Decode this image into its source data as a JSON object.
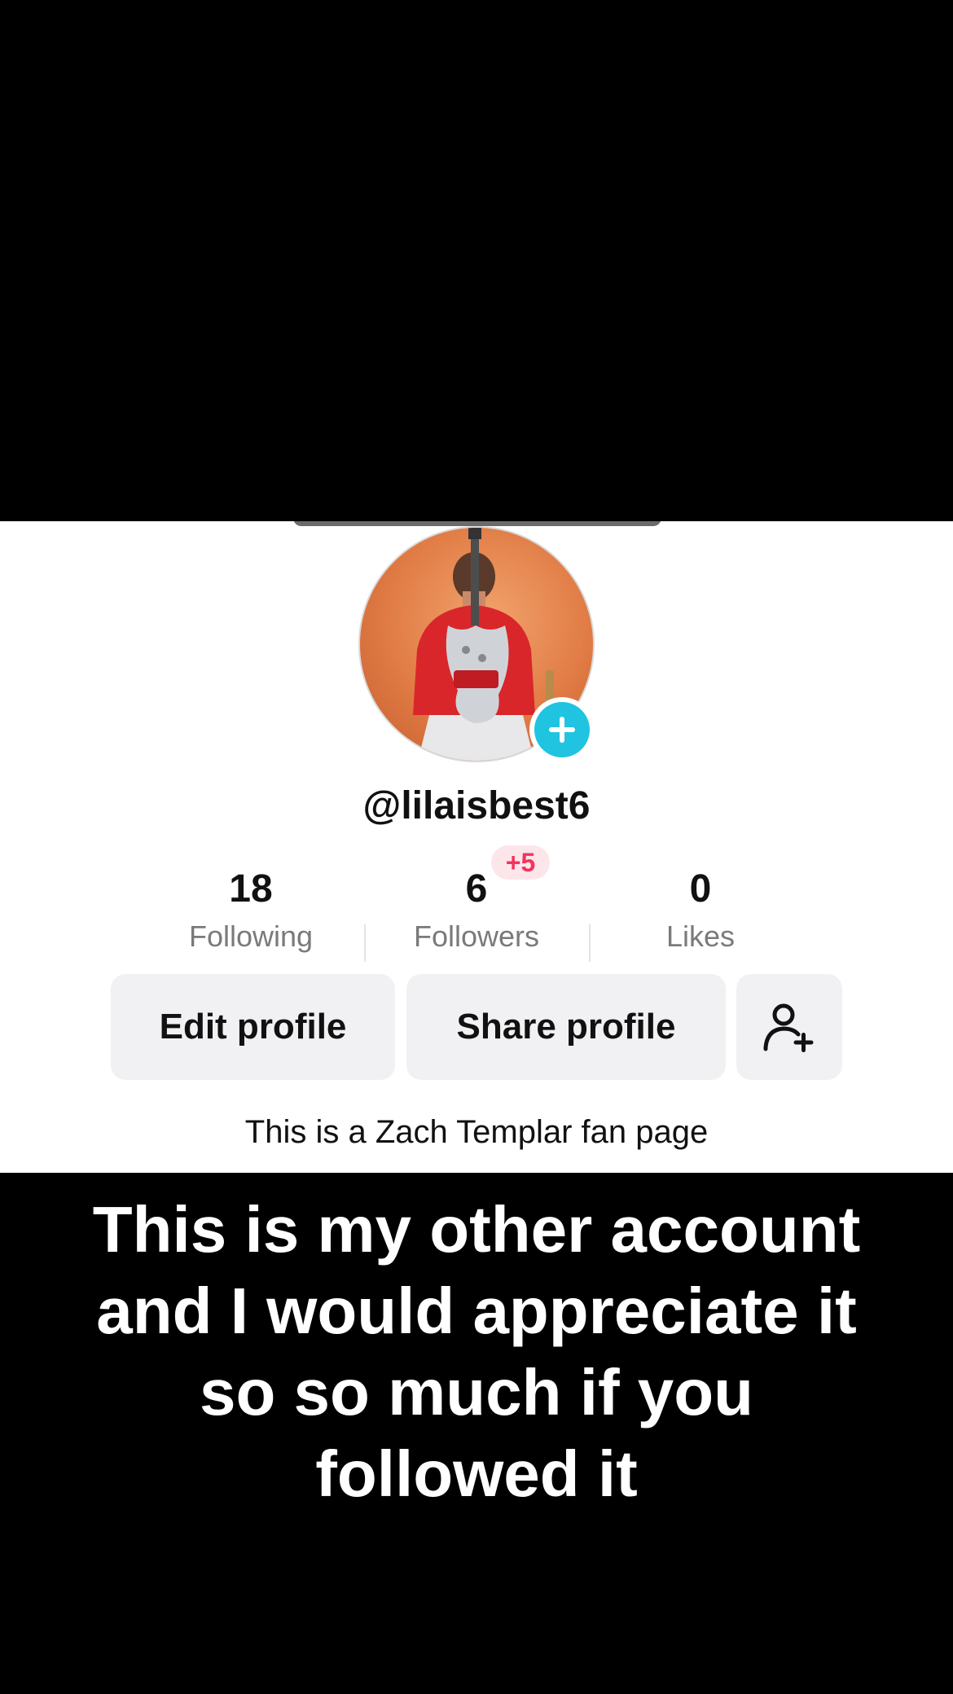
{
  "profile": {
    "username": "@lilaisbest6",
    "bio": "This is a Zach Templar fan page",
    "avatar_icon": "profile-photo-guitar",
    "add_icon": "plus-icon"
  },
  "stats": {
    "following": {
      "count": "18",
      "label": "Following"
    },
    "followers": {
      "count": "6",
      "label": "Followers",
      "new_badge": "+5"
    },
    "likes": {
      "count": "0",
      "label": "Likes"
    }
  },
  "buttons": {
    "edit": "Edit profile",
    "share": "Share profile",
    "add_friend_icon": "add-user-icon"
  },
  "caption": {
    "line1": "This is my other account",
    "line2": "and I would appreciate it",
    "line3": "so so much if you",
    "line4": "followed it"
  },
  "colors": {
    "accent": "#20c4e1",
    "badge_text": "#f1355e",
    "badge_bg": "#fde6ea",
    "button_bg": "#f1f1f3",
    "muted_text": "#7a7a7a"
  }
}
